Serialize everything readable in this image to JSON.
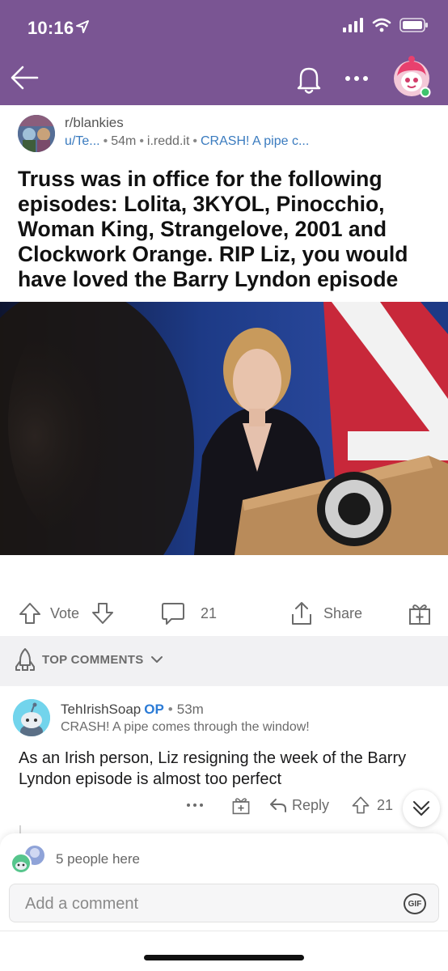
{
  "status_bar": {
    "time": "10:16"
  },
  "header": {
    "back_icon": "arrow-left-icon",
    "bell_icon": "bell-icon",
    "more_icon": "more-dots-icon",
    "colors": {
      "background": "#7a5593"
    }
  },
  "post": {
    "subreddit": "r/blankies",
    "author": "u/Te...",
    "age": "54m",
    "domain": "i.redd.it",
    "flair": "CRASH! A pipe c...",
    "title": "Truss was in office for the following episodes: Lolita, 3KYOL, Pinocchio, Woman King, Strangelove, 2001 and Clockwork Orange. RIP Liz, you would have loved the Barry Lyndon episode"
  },
  "actions": {
    "vote_label": "Vote",
    "comments_count": "21",
    "share_label": "Share"
  },
  "sort": {
    "label": "TOP COMMENTS"
  },
  "comment": {
    "username": "TehIrishSoap",
    "op_badge": "OP",
    "age": "53m",
    "flair": "CRASH! A pipe comes through the window!",
    "body": "As an Irish person, Liz resigning the week of the Barry Lyndon episode is almost too perfect",
    "reply_label": "Reply",
    "score": "21"
  },
  "bottom": {
    "presence_text": "5 people here",
    "comment_placeholder": "Add a comment",
    "gif_label": "GIF"
  }
}
